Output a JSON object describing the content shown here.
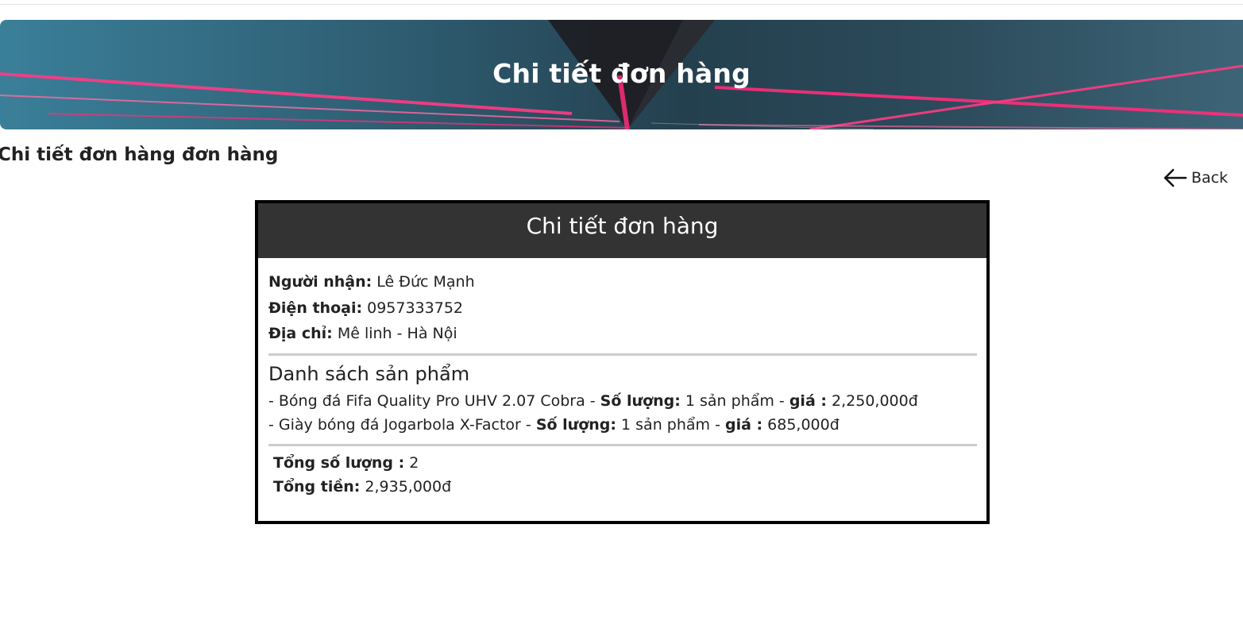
{
  "banner": {
    "title": "Chi tiết đơn hàng"
  },
  "page": {
    "heading": "Chi tiết đơn hàng đơn hàng",
    "back_label": "Back"
  },
  "card": {
    "title": "Chi tiết đơn hàng",
    "recipient": {
      "label": "Người nhận:",
      "value": "Lê Đức Mạnh"
    },
    "phone": {
      "label": "Điện thoại:",
      "value": "0957333752"
    },
    "address": {
      "label": "Địa chỉ:",
      "value": "Mê linh - Hà Nội"
    },
    "products_title": "Danh sách sản phẩm",
    "products": [
      {
        "name": "- Bóng đá Fifa Quality Pro UHV 2.07 Cobra - ",
        "qty_label": "Số lượng:",
        "qty": " 1 sản phẩm - ",
        "price_label": "giá :",
        "price": " 2,250,000đ"
      },
      {
        "name": "- Giày bóng đá Jogarbola X-Factor - ",
        "qty_label": "Số lượng:",
        "qty": " 1 sản phẩm - ",
        "price_label": "giá :",
        "price": " 685,000đ"
      }
    ],
    "total_qty": {
      "label": "Tổng số lượng :",
      "value": " 2"
    },
    "total_price": {
      "label": "Tổng tiền:",
      "value": " 2,935,000đ"
    }
  },
  "icons": {
    "back": "arrow-left-icon"
  },
  "colors": {
    "banner_accent": "#ff2d7a",
    "card_header": "#333333",
    "card_border": "#000000"
  }
}
